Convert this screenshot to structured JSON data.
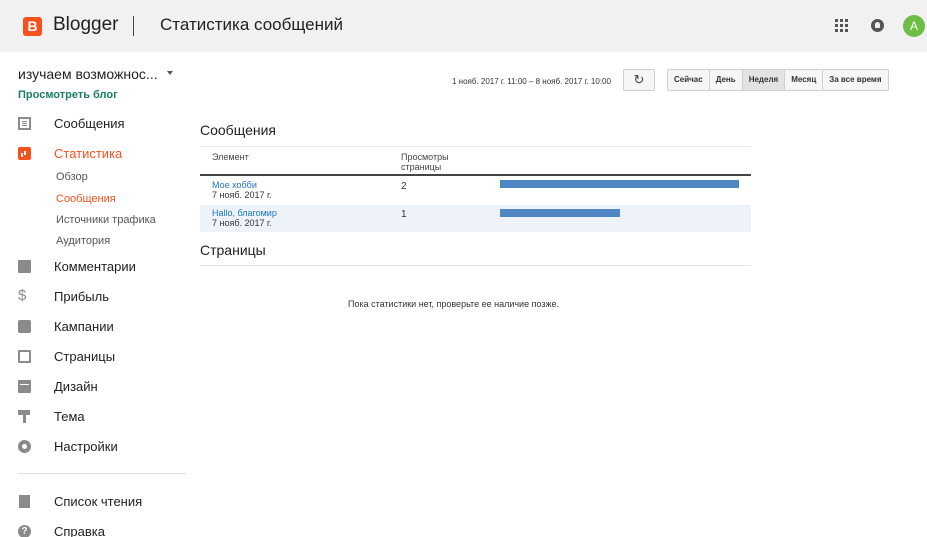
{
  "header": {
    "logo_letter": "B",
    "app_name": "Blogger",
    "page_title": "Статистика сообщений",
    "avatar_letter": "A",
    "colors": {
      "brand": "#f4511e",
      "avatar": "#6ebd44",
      "header_bg": "#f1f1f1"
    }
  },
  "sidebar": {
    "blog_name": "изучаем возможнос...",
    "view_blog": "Просмотреть блог",
    "items": [
      {
        "label": "Сообщения",
        "icon": "posts-icon"
      },
      {
        "label": "Статистика",
        "icon": "stats-icon",
        "active": true
      },
      {
        "label": "Комментарии",
        "icon": "comment-icon"
      },
      {
        "label": "Прибыль",
        "icon": "dollar-icon"
      },
      {
        "label": "Кампании",
        "icon": "campaigns-icon"
      },
      {
        "label": "Страницы",
        "icon": "pages-icon"
      },
      {
        "label": "Дизайн",
        "icon": "layout-icon"
      },
      {
        "label": "Тема",
        "icon": "theme-icon"
      },
      {
        "label": "Настройки",
        "icon": "gear-icon"
      }
    ],
    "stats_sub": [
      {
        "label": "Обзор"
      },
      {
        "label": "Сообщения",
        "active": true
      },
      {
        "label": "Источники трафика"
      },
      {
        "label": "Аудитория"
      }
    ],
    "bottom_items": [
      {
        "label": "Список чтения",
        "icon": "bookmark-icon"
      },
      {
        "label": "Справка",
        "icon": "help-icon"
      }
    ]
  },
  "toolbar": {
    "date_range": "1 нояб. 2017 г. 11:00 – 8 нояб. 2017 г. 10:00",
    "refresh_symbol": "↻",
    "ranges": [
      "Сейчас",
      "День",
      "Неделя",
      "Месяц",
      "За все время"
    ],
    "active_range": "Неделя"
  },
  "posts": {
    "title": "Сообщения",
    "col_element": "Элемент",
    "col_views_line1": "Просмотры",
    "col_views_line2": "страницы",
    "rows": [
      {
        "title": "Мое хобби",
        "date": "7 нояб. 2017 г.",
        "views": "2",
        "fraction": 1.0
      },
      {
        "title": "Hallo, благомир",
        "date": "7 нояб. 2017 г.",
        "views": "1",
        "fraction": 0.5
      }
    ],
    "bar_color": "#4f86c3"
  },
  "pages": {
    "title": "Страницы",
    "empty_message": "Пока статистики нет, проверьте ее наличие позже."
  }
}
